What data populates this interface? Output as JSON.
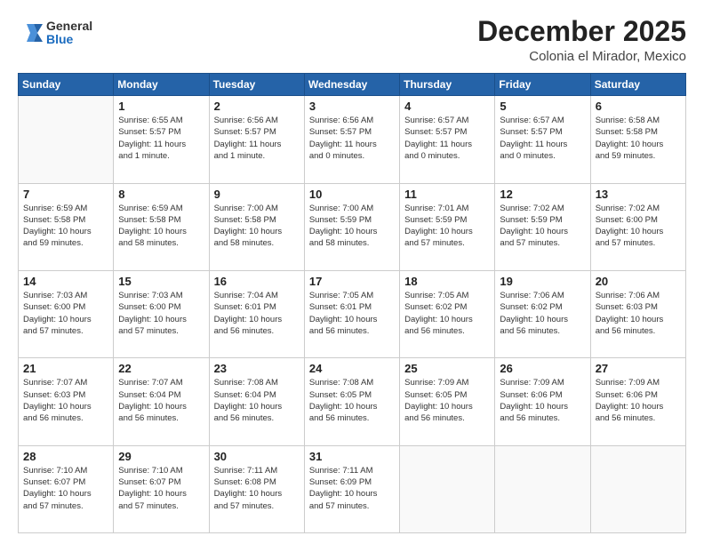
{
  "header": {
    "logo_general": "General",
    "logo_blue": "Blue",
    "month_title": "December 2025",
    "location": "Colonia el Mirador, Mexico"
  },
  "calendar": {
    "days_of_week": [
      "Sunday",
      "Monday",
      "Tuesday",
      "Wednesday",
      "Thursday",
      "Friday",
      "Saturday"
    ],
    "weeks": [
      [
        {
          "day": "",
          "info": ""
        },
        {
          "day": "1",
          "info": "Sunrise: 6:55 AM\nSunset: 5:57 PM\nDaylight: 11 hours\nand 1 minute."
        },
        {
          "day": "2",
          "info": "Sunrise: 6:56 AM\nSunset: 5:57 PM\nDaylight: 11 hours\nand 1 minute."
        },
        {
          "day": "3",
          "info": "Sunrise: 6:56 AM\nSunset: 5:57 PM\nDaylight: 11 hours\nand 0 minutes."
        },
        {
          "day": "4",
          "info": "Sunrise: 6:57 AM\nSunset: 5:57 PM\nDaylight: 11 hours\nand 0 minutes."
        },
        {
          "day": "5",
          "info": "Sunrise: 6:57 AM\nSunset: 5:57 PM\nDaylight: 11 hours\nand 0 minutes."
        },
        {
          "day": "6",
          "info": "Sunrise: 6:58 AM\nSunset: 5:58 PM\nDaylight: 10 hours\nand 59 minutes."
        }
      ],
      [
        {
          "day": "7",
          "info": "Sunrise: 6:59 AM\nSunset: 5:58 PM\nDaylight: 10 hours\nand 59 minutes."
        },
        {
          "day": "8",
          "info": "Sunrise: 6:59 AM\nSunset: 5:58 PM\nDaylight: 10 hours\nand 58 minutes."
        },
        {
          "day": "9",
          "info": "Sunrise: 7:00 AM\nSunset: 5:58 PM\nDaylight: 10 hours\nand 58 minutes."
        },
        {
          "day": "10",
          "info": "Sunrise: 7:00 AM\nSunset: 5:59 PM\nDaylight: 10 hours\nand 58 minutes."
        },
        {
          "day": "11",
          "info": "Sunrise: 7:01 AM\nSunset: 5:59 PM\nDaylight: 10 hours\nand 57 minutes."
        },
        {
          "day": "12",
          "info": "Sunrise: 7:02 AM\nSunset: 5:59 PM\nDaylight: 10 hours\nand 57 minutes."
        },
        {
          "day": "13",
          "info": "Sunrise: 7:02 AM\nSunset: 6:00 PM\nDaylight: 10 hours\nand 57 minutes."
        }
      ],
      [
        {
          "day": "14",
          "info": "Sunrise: 7:03 AM\nSunset: 6:00 PM\nDaylight: 10 hours\nand 57 minutes."
        },
        {
          "day": "15",
          "info": "Sunrise: 7:03 AM\nSunset: 6:00 PM\nDaylight: 10 hours\nand 57 minutes."
        },
        {
          "day": "16",
          "info": "Sunrise: 7:04 AM\nSunset: 6:01 PM\nDaylight: 10 hours\nand 56 minutes."
        },
        {
          "day": "17",
          "info": "Sunrise: 7:05 AM\nSunset: 6:01 PM\nDaylight: 10 hours\nand 56 minutes."
        },
        {
          "day": "18",
          "info": "Sunrise: 7:05 AM\nSunset: 6:02 PM\nDaylight: 10 hours\nand 56 minutes."
        },
        {
          "day": "19",
          "info": "Sunrise: 7:06 AM\nSunset: 6:02 PM\nDaylight: 10 hours\nand 56 minutes."
        },
        {
          "day": "20",
          "info": "Sunrise: 7:06 AM\nSunset: 6:03 PM\nDaylight: 10 hours\nand 56 minutes."
        }
      ],
      [
        {
          "day": "21",
          "info": "Sunrise: 7:07 AM\nSunset: 6:03 PM\nDaylight: 10 hours\nand 56 minutes."
        },
        {
          "day": "22",
          "info": "Sunrise: 7:07 AM\nSunset: 6:04 PM\nDaylight: 10 hours\nand 56 minutes."
        },
        {
          "day": "23",
          "info": "Sunrise: 7:08 AM\nSunset: 6:04 PM\nDaylight: 10 hours\nand 56 minutes."
        },
        {
          "day": "24",
          "info": "Sunrise: 7:08 AM\nSunset: 6:05 PM\nDaylight: 10 hours\nand 56 minutes."
        },
        {
          "day": "25",
          "info": "Sunrise: 7:09 AM\nSunset: 6:05 PM\nDaylight: 10 hours\nand 56 minutes."
        },
        {
          "day": "26",
          "info": "Sunrise: 7:09 AM\nSunset: 6:06 PM\nDaylight: 10 hours\nand 56 minutes."
        },
        {
          "day": "27",
          "info": "Sunrise: 7:09 AM\nSunset: 6:06 PM\nDaylight: 10 hours\nand 56 minutes."
        }
      ],
      [
        {
          "day": "28",
          "info": "Sunrise: 7:10 AM\nSunset: 6:07 PM\nDaylight: 10 hours\nand 57 minutes."
        },
        {
          "day": "29",
          "info": "Sunrise: 7:10 AM\nSunset: 6:07 PM\nDaylight: 10 hours\nand 57 minutes."
        },
        {
          "day": "30",
          "info": "Sunrise: 7:11 AM\nSunset: 6:08 PM\nDaylight: 10 hours\nand 57 minutes."
        },
        {
          "day": "31",
          "info": "Sunrise: 7:11 AM\nSunset: 6:09 PM\nDaylight: 10 hours\nand 57 minutes."
        },
        {
          "day": "",
          "info": ""
        },
        {
          "day": "",
          "info": ""
        },
        {
          "day": "",
          "info": ""
        }
      ]
    ]
  }
}
